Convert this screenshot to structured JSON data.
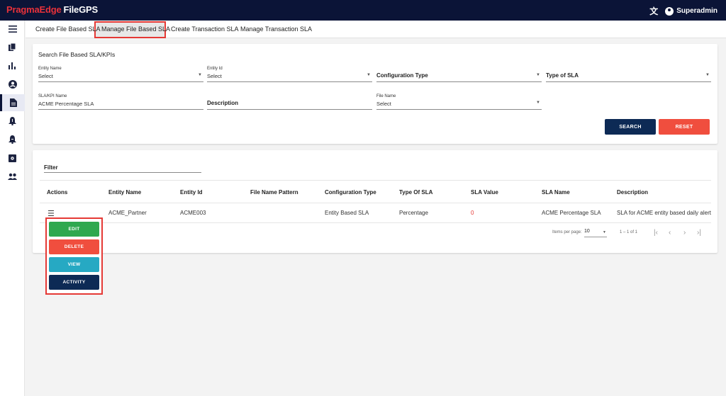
{
  "app": {
    "brand_part1": "PragmaEdge",
    "brand_part2": "FileGPS",
    "user": "Superadmin"
  },
  "tabs": [
    {
      "label": "Create File Based SLA"
    },
    {
      "label": "Manage File Based SLA"
    },
    {
      "label": "Create Transaction SLA"
    },
    {
      "label": "Manage Transaction SLA"
    }
  ],
  "search": {
    "title": "Search File Based SLA/KPIs",
    "entity_name": {
      "label": "Entity Name",
      "value": "Select"
    },
    "entity_id": {
      "label": "Entity Id",
      "value": "Select"
    },
    "configuration_type": {
      "placeholder": "Configuration Type"
    },
    "type_of_sla": {
      "placeholder": "Type of SLA"
    },
    "sla_kpi_name": {
      "label": "SLA/KPI Name",
      "value": "ACME Percentage SLA"
    },
    "description": {
      "placeholder": "Description"
    },
    "file_name": {
      "label": "File Name",
      "value": "Select"
    },
    "search_button": "SEARCH",
    "reset_button": "RESET"
  },
  "results": {
    "filter_label": "Filter",
    "columns": [
      "Actions",
      "Entity Name",
      "Entity Id",
      "File Name Pattern",
      "Configuration Type",
      "Type Of SLA",
      "SLA Value",
      "SLA Name",
      "Description"
    ],
    "rows": [
      {
        "entity_name": "ACME_Partner",
        "entity_id": "ACME003",
        "file_name_pattern": "",
        "configuration_type": "Entity Based SLA",
        "type_of_sla": "Percentage",
        "sla_value": "0",
        "sla_name": "ACME Percentage SLA",
        "description": "SLA for ACME entity based daily alert"
      }
    ],
    "paginator": {
      "items_per_page_label": "Items per page:",
      "items_per_page": "10",
      "range": "1 – 1 of 1"
    }
  },
  "row_actions": {
    "edit": "EDIT",
    "delete": "DELETE",
    "view": "VIEW",
    "activity": "ACTIVITY"
  },
  "colors": {
    "topbar": "#0b1437",
    "brand_red": "#e8313a",
    "search_btn": "#0d2a55",
    "reset_btn": "#f04e3e",
    "edit": "#2fa84f",
    "view": "#26a9c3",
    "highlight": "#e53935"
  }
}
